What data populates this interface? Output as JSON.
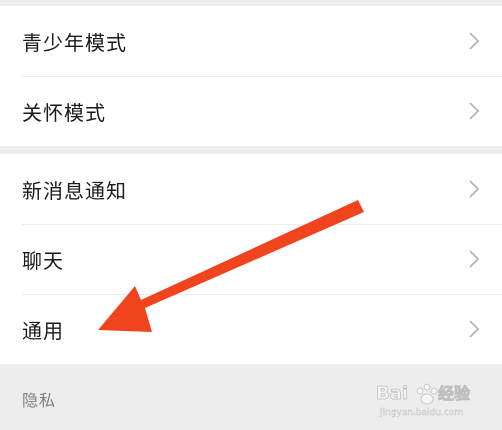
{
  "group1": {
    "items": [
      {
        "label": "青少年模式"
      },
      {
        "label": "关怀模式"
      }
    ]
  },
  "group2": {
    "items": [
      {
        "label": "新消息通知"
      },
      {
        "label": "聊天"
      },
      {
        "label": "通用"
      }
    ]
  },
  "section": {
    "privacy_label": "隐私"
  },
  "icons": {
    "chevron": "chevron-right-icon"
  },
  "colors": {
    "background": "#ededed",
    "row_background": "#ffffff",
    "annotation_arrow": "#f0441f"
  },
  "watermark": {
    "text": "Bai经验",
    "sub": "jingyan.baidu.com"
  }
}
